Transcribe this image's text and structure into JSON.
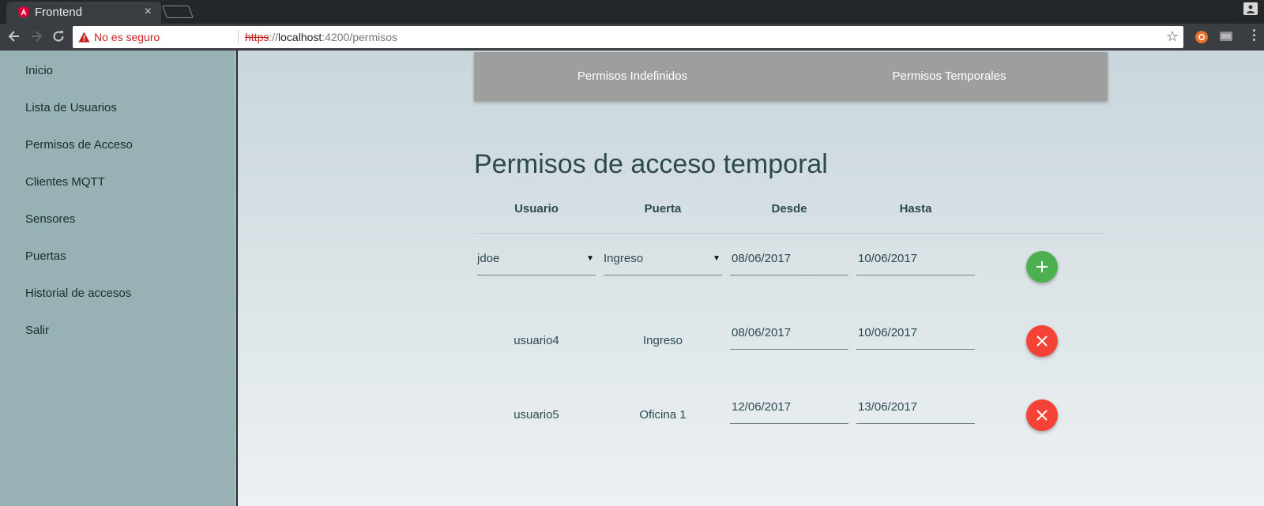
{
  "browser": {
    "tab_title": "Frontend",
    "tab_close": "×",
    "security_label": "No es seguro",
    "url_scheme": "https",
    "url_sep": "://",
    "url_host": "localhost",
    "url_rest": ":4200/permisos",
    "star": "☆"
  },
  "sidebar": {
    "items": [
      {
        "label": "Inicio"
      },
      {
        "label": "Lista de Usuarios"
      },
      {
        "label": "Permisos de Acceso"
      },
      {
        "label": "Clientes MQTT"
      },
      {
        "label": "Sensores"
      },
      {
        "label": "Puertas"
      },
      {
        "label": "Historial de accesos"
      },
      {
        "label": "Salir"
      }
    ]
  },
  "tabs": [
    {
      "label": "Permisos Indefinidos"
    },
    {
      "label": "Permisos Temporales"
    }
  ],
  "page_title": "Permisos de acceso temporal",
  "table": {
    "headers": [
      "Usuario",
      "Puerta",
      "Desde",
      "Hasta"
    ],
    "new_row": {
      "usuario": "jdoe",
      "puerta": "Ingreso",
      "desde": "08/06/2017",
      "hasta": "10/06/2017",
      "caret": "▼"
    },
    "rows": [
      {
        "usuario": "usuario4",
        "puerta": "Ingreso",
        "desde": "08/06/2017",
        "hasta": "10/06/2017"
      },
      {
        "usuario": "usuario5",
        "puerta": "Oficina 1",
        "desde": "12/06/2017",
        "hasta": "13/06/2017"
      }
    ]
  },
  "colors": {
    "add": "#4caf50",
    "delete": "#f44336",
    "sidebar": "#97b1b4",
    "tabs": "#9e9e9e"
  },
  "icons": {
    "add_button": "plus-icon",
    "delete_button": "close-icon"
  }
}
